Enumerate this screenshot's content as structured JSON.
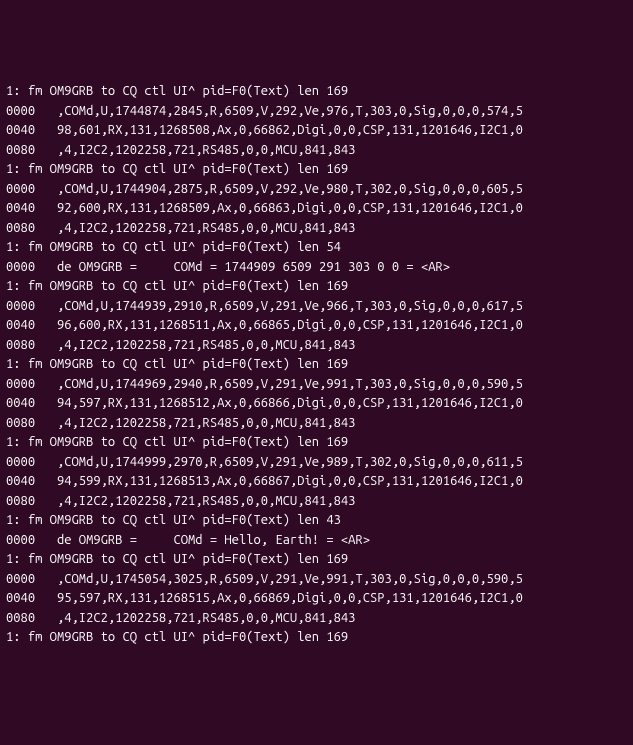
{
  "terminal": {
    "lines": [
      "1: fm OM9GRB to CQ ctl UI^ pid=F0(Text) len 169",
      "0000   ,COMd,U,1744874,2845,R,6509,V,292,Ve,976,T,303,0,Sig,0,0,0,574,5",
      "0040   98,601,RX,131,1268508,Ax,0,66862,Digi,0,0,CSP,131,1201646,I2C1,0",
      "0080   ,4,I2C2,1202258,721,RS485,0,0,MCU,841,843",
      "1: fm OM9GRB to CQ ctl UI^ pid=F0(Text) len 169",
      "0000   ,COMd,U,1744904,2875,R,6509,V,292,Ve,980,T,302,0,Sig,0,0,0,605,5",
      "0040   92,600,RX,131,1268509,Ax,0,66863,Digi,0,0,CSP,131,1201646,I2C1,0",
      "0080   ,4,I2C2,1202258,721,RS485,0,0,MCU,841,843",
      "1: fm OM9GRB to CQ ctl UI^ pid=F0(Text) len 54",
      "0000   de OM9GRB =     COMd = 1744909 6509 291 303 0 0 = <AR>",
      "1: fm OM9GRB to CQ ctl UI^ pid=F0(Text) len 169",
      "0000   ,COMd,U,1744939,2910,R,6509,V,291,Ve,966,T,303,0,Sig,0,0,0,617,5",
      "0040   96,600,RX,131,1268511,Ax,0,66865,Digi,0,0,CSP,131,1201646,I2C1,0",
      "0080   ,4,I2C2,1202258,721,RS485,0,0,MCU,841,843",
      "1: fm OM9GRB to CQ ctl UI^ pid=F0(Text) len 169",
      "0000   ,COMd,U,1744969,2940,R,6509,V,291,Ve,991,T,303,0,Sig,0,0,0,590,5",
      "0040   94,597,RX,131,1268512,Ax,0,66866,Digi,0,0,CSP,131,1201646,I2C1,0",
      "0080   ,4,I2C2,1202258,721,RS485,0,0,MCU,841,843",
      "1: fm OM9GRB to CQ ctl UI^ pid=F0(Text) len 169",
      "0000   ,COMd,U,1744999,2970,R,6509,V,291,Ve,989,T,302,0,Sig,0,0,0,611,5",
      "0040   94,599,RX,131,1268513,Ax,0,66867,Digi,0,0,CSP,131,1201646,I2C1,0",
      "0080   ,4,I2C2,1202258,721,RS485,0,0,MCU,841,843",
      "1: fm OM9GRB to CQ ctl UI^ pid=F0(Text) len 43",
      "0000   de OM9GRB =     COMd = Hello, Earth! = <AR>",
      "1: fm OM9GRB to CQ ctl UI^ pid=F0(Text) len 169",
      "0000   ,COMd,U,1745054,3025,R,6509,V,291,Ve,991,T,303,0,Sig,0,0,0,590,5",
      "0040   95,597,RX,131,1268515,Ax,0,66869,Digi,0,0,CSP,131,1201646,I2C1,0",
      "0080   ,4,I2C2,1202258,721,RS485,0,0,MCU,841,843",
      "1: fm OM9GRB to CQ ctl UI^ pid=F0(Text) len 169"
    ]
  }
}
